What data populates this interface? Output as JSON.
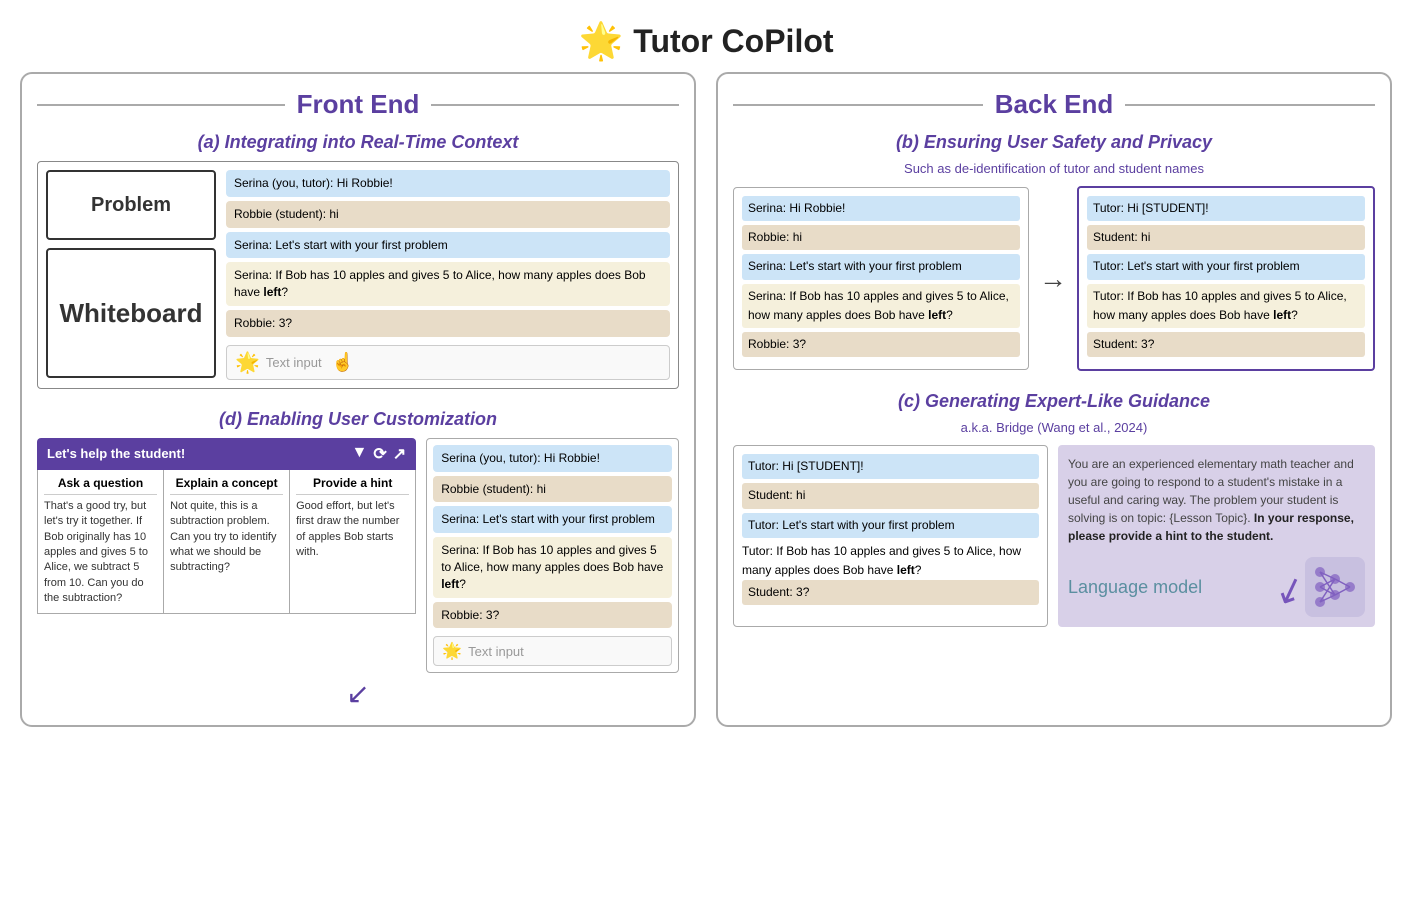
{
  "title": {
    "logo": "🌟",
    "text": "Tutor CoPilot"
  },
  "frontend": {
    "header": "Front End",
    "section_a": {
      "title": "(a) Integrating into Real-Time Context",
      "problem_label": "Problem",
      "whiteboard_label": "Whiteboard",
      "chat": [
        {
          "type": "blue",
          "text": "Serina (you, tutor): Hi Robbie!"
        },
        {
          "type": "tan",
          "text": "Robbie (student): hi"
        },
        {
          "type": "blue",
          "text": "Serina: Let's start with your first problem"
        },
        {
          "type": "yellow",
          "text": "Serina: If Bob has 10 apples and gives 5 to Alice, how many apples does Bob have left?"
        },
        {
          "type": "tan",
          "text": "Robbie: 3?"
        }
      ],
      "text_input_placeholder": "Text input"
    },
    "section_d": {
      "title": "(d) Enabling User Customization",
      "header_label": "Let's help the student!",
      "header_icons": [
        "▼",
        "⟳",
        "↗"
      ],
      "columns": [
        {
          "header": "Ask a question",
          "body": "That's a good try, but let's try it together. If Bob originally has 10 apples and gives 5 to Alice, we subtract 5 from 10. Can you do the subtraction?"
        },
        {
          "header": "Explain a concept",
          "body": "Not quite, this is a subtraction problem. Can you try to identify what we should be subtracting?"
        },
        {
          "header": "Provide a hint",
          "body": "Good effort, but let's first draw the number of apples Bob starts with."
        }
      ],
      "chat": [
        {
          "type": "blue",
          "text": "Serina (you, tutor): Hi Robbie!"
        },
        {
          "type": "tan",
          "text": "Robbie (student): hi"
        },
        {
          "type": "blue",
          "text": "Serina: Let's start with your first problem"
        },
        {
          "type": "yellow",
          "text": "Serina: If Bob has 10 apples and gives 5 to Alice, how many apples does Bob have left?"
        },
        {
          "type": "tan",
          "text": "Robbie: 3?"
        }
      ],
      "text_input_placeholder": "Text input"
    }
  },
  "backend": {
    "header": "Back End",
    "section_b": {
      "title": "(b) Ensuring User Safety and Privacy",
      "subtitle": "Such as de-identification of tutor and student names",
      "left_panel": [
        {
          "type": "blue",
          "text": "Serina: Hi Robbie!"
        },
        {
          "type": "tan",
          "text": "Robbie: hi"
        },
        {
          "type": "blue",
          "text": "Serina: Let's start with your first problem"
        },
        {
          "type": "yellow",
          "text": "Serina: If Bob has 10 apples and gives 5 to Alice, how many apples does Bob have left?"
        },
        {
          "type": "tan",
          "text": "Robbie: 3?"
        }
      ],
      "right_panel": [
        {
          "type": "blue",
          "text": "Tutor: Hi [STUDENT]!"
        },
        {
          "type": "tan",
          "text": "Student: hi"
        },
        {
          "type": "blue",
          "text": "Tutor: Let's start with your first problem"
        },
        {
          "type": "yellow",
          "text": "Tutor: If Bob has 10 apples and gives 5 to Alice, how many apples does Bob have left?"
        },
        {
          "type": "tan",
          "text": "Student: 3?"
        }
      ]
    },
    "section_c": {
      "title": "(c) Generating Expert-Like Guidance",
      "subtitle": "a.k.a. Bridge (Wang et al., 2024)",
      "left_panel": [
        {
          "type": "blue",
          "text": "Tutor: Hi [STUDENT]!"
        },
        {
          "type": "tan",
          "text": "Student: hi"
        },
        {
          "type": "blue",
          "text": "Tutor: Let's start with your first problem"
        },
        {
          "type": "yellow",
          "text": "Tutor: If Bob has 10 apples and gives 5 to Alice, how many apples does Bob have left?"
        },
        {
          "type": "tan",
          "text": "Student: 3?"
        }
      ],
      "right_panel_text": "You are an experienced elementary math teacher and you are going to respond to a student's mistake in a useful and caring way. The problem your student is solving is on topic: {Lesson Topic}.",
      "right_panel_bold": "In your response, please provide a hint to the student.",
      "lm_label": "Language model"
    }
  }
}
